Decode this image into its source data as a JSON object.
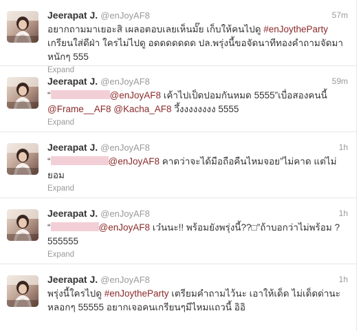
{
  "tweets": [
    {
      "fullname": "Jeerapat J.",
      "username": "@enJoyAF8",
      "time": "57m",
      "line1a": "อยากถามมาเยอะสิ เผลอตอบเลยเห็นมั๊ย เก็บให้คนไปดู ",
      "hashtag1": "#enJoytheParty",
      "line2": "เกรียนใส่ดีฝ่า ใครไม่ไปดู อดดดดดดด ปล.พรุ่งนี้ขอจัดนาทีทองคำถามจัดมา",
      "line3": "หนักๆ 555",
      "expand": "Expand"
    },
    {
      "fullname": "Jeerapat J.",
      "username": "@enJoyAF8",
      "time": "59m",
      "quote_open": "“",
      "mention1": "@enJoyAF8",
      "line1b": " เค้าไปเป็ดปอมกันหมด 5555”เบื่อสองคนนี้",
      "mention2": "@Frame__AF8",
      "mention3": "@Kacha_AF8",
      "line2b": " วึ้งงงงงงงง 5555",
      "expand": "Expand"
    },
    {
      "fullname": "Jeerapat J.",
      "username": "@enJoyAF8",
      "time": "1h",
      "quote_open": "“",
      "mention1": "@enJoyAF8",
      "line1b": " คาดว่าจะได้มือถือคืนไหมจอย”ไม่คาด แต่ไม่",
      "line2": "ยอม",
      "expand": "Expand"
    },
    {
      "fullname": "Jeerapat J.",
      "username": "@enJoyAF8",
      "time": "1h",
      "quote_open": "“",
      "mention1": "@enJoyAF8",
      "line1b": " เว๋นนะ!! พร้อมยังพรุ่งนี้??□”ถ้าบอกว่าไม่พร้อม ?",
      "line2": "555555",
      "expand": "Expand"
    },
    {
      "fullname": "Jeerapat J.",
      "username": "@enJoyAF8",
      "time": "1h",
      "line1a": "พรุ่งนี้ใครไปดู ",
      "hashtag1": "#enJoytheParty",
      "line1b": " เตรียมคำถามไว้นะ เอาให้เด็ด ไม่เด็ดด่านะ",
      "line2": "หลอกๆ 55555 อยากเจอคนเกรียนๆมีไหมแถวนี้ อิอิ"
    }
  ],
  "colors": {
    "link": "#8b2a2a",
    "muted": "#999999",
    "redaction": "#f2cfd6"
  }
}
